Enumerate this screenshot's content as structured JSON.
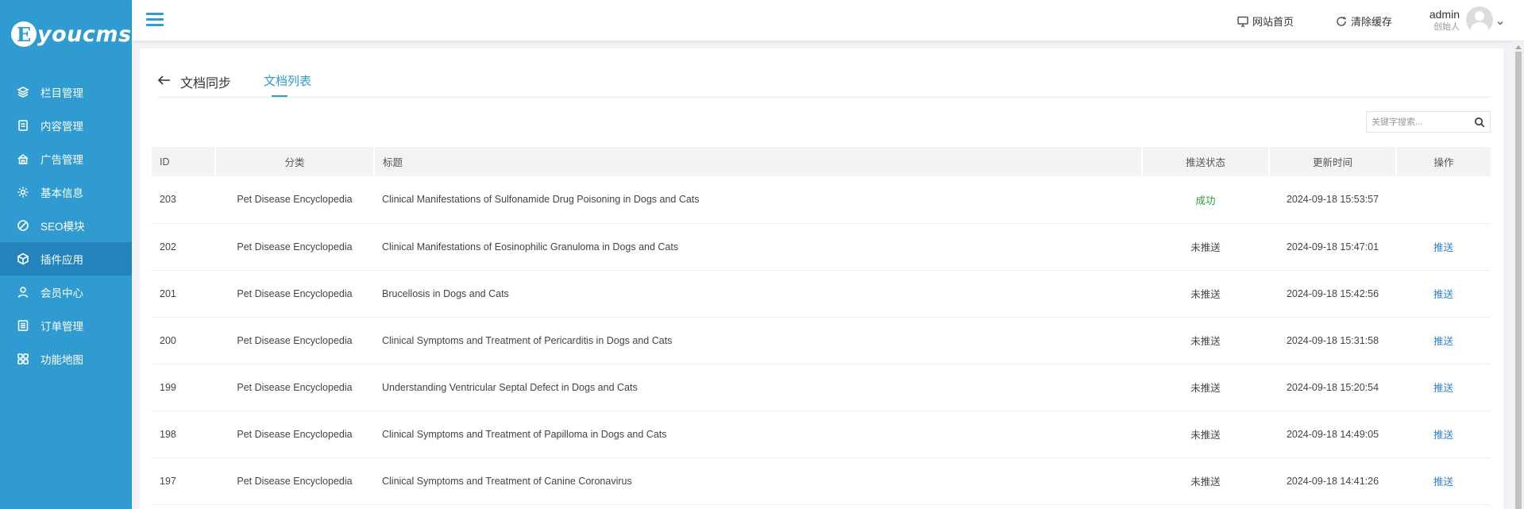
{
  "sidebar": {
    "logo_letter": "E",
    "logo_text": "youcms",
    "items": [
      {
        "label": "栏目管理",
        "icon": "layers-icon"
      },
      {
        "label": "内容管理",
        "icon": "document-icon"
      },
      {
        "label": "广告管理",
        "icon": "ad-icon"
      },
      {
        "label": "基本信息",
        "icon": "gear-icon"
      },
      {
        "label": "SEO模块",
        "icon": "seo-icon"
      },
      {
        "label": "插件应用",
        "icon": "cube-icon",
        "active": true
      },
      {
        "label": "会员中心",
        "icon": "user-icon"
      },
      {
        "label": "订单管理",
        "icon": "list-icon"
      },
      {
        "label": "功能地图",
        "icon": "grid-icon"
      }
    ]
  },
  "topbar": {
    "home_label": "网站首页",
    "clear_cache_label": "清除缓存",
    "user_name": "admin",
    "user_role": "创始人"
  },
  "page": {
    "title": "文档同步",
    "active_tab": "文档列表",
    "search_placeholder": "关键字搜索...",
    "columns": [
      "ID",
      "分类",
      "标题",
      "推送状态",
      "更新时间",
      "操作"
    ],
    "rows": [
      {
        "id": "203",
        "category": "Pet Disease Encyclopedia",
        "title": "Clinical Manifestations of Sulfonamide Drug Poisoning in Dogs and Cats",
        "status": "成功",
        "updated": "2024-09-18 15:53:57",
        "action": ""
      },
      {
        "id": "202",
        "category": "Pet Disease Encyclopedia",
        "title": "Clinical Manifestations of Eosinophilic Granuloma in Dogs and Cats",
        "status": "未推送",
        "updated": "2024-09-18 15:47:01",
        "action": "推送"
      },
      {
        "id": "201",
        "category": "Pet Disease Encyclopedia",
        "title": "Brucellosis in Dogs and Cats",
        "status": "未推送",
        "updated": "2024-09-18 15:42:56",
        "action": "推送"
      },
      {
        "id": "200",
        "category": "Pet Disease Encyclopedia",
        "title": "Clinical Symptoms and Treatment of Pericarditis in Dogs and Cats",
        "status": "未推送",
        "updated": "2024-09-18 15:31:58",
        "action": "推送"
      },
      {
        "id": "199",
        "category": "Pet Disease Encyclopedia",
        "title": "Understanding Ventricular Septal Defect in Dogs and Cats",
        "status": "未推送",
        "updated": "2024-09-18 15:20:54",
        "action": "推送"
      },
      {
        "id": "198",
        "category": "Pet Disease Encyclopedia",
        "title": "Clinical Symptoms and Treatment of Papilloma in Dogs and Cats",
        "status": "未推送",
        "updated": "2024-09-18 14:49:05",
        "action": "推送"
      },
      {
        "id": "197",
        "category": "Pet Disease Encyclopedia",
        "title": "Clinical Symptoms and Treatment of Canine Coronavirus",
        "status": "未推送",
        "updated": "2024-09-18 14:41:26",
        "action": "推送"
      }
    ]
  },
  "colors": {
    "sidebar_bg": "#2f9bd0",
    "sidebar_active": "#2284bb",
    "accent": "#2f9bd0",
    "success": "#2a9d3a",
    "link": "#2f7fd0"
  }
}
